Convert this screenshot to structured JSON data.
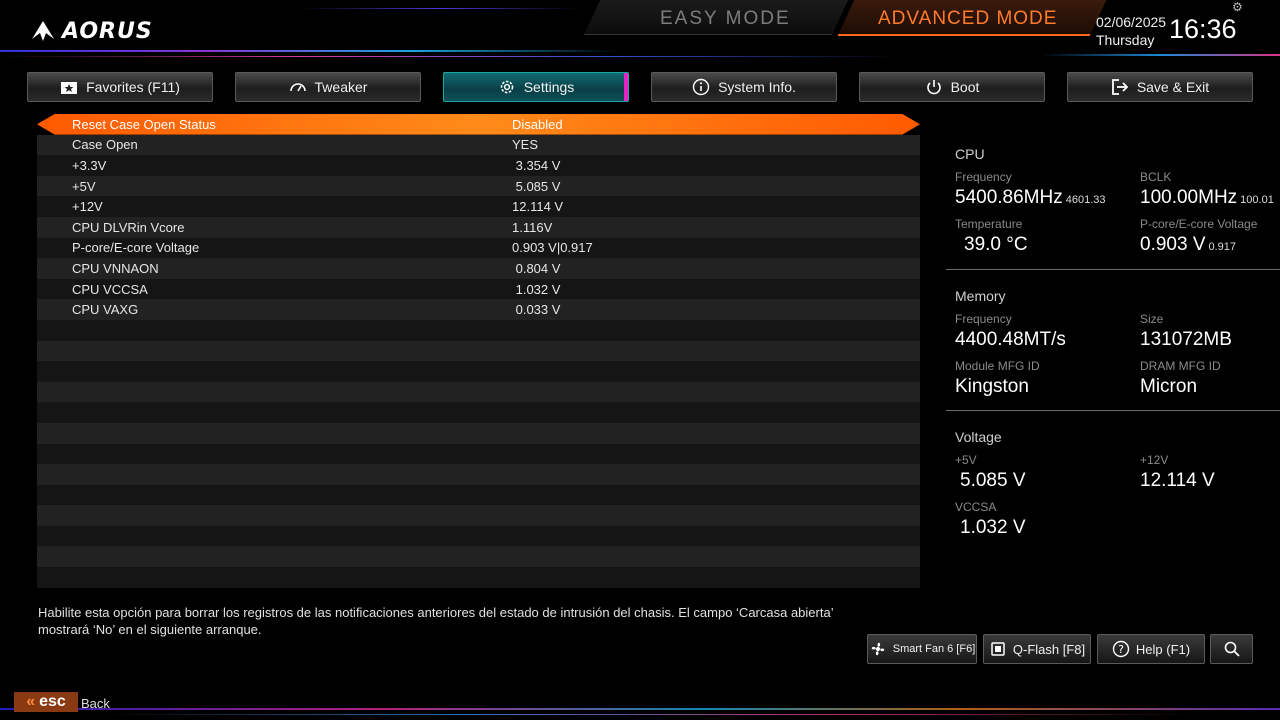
{
  "header": {
    "logo_text": "AORUS",
    "easy_mode": "EASY MODE",
    "advanced_mode": "ADVANCED MODE",
    "date": "02/06/2025",
    "day": "Thursday",
    "time": "16:36"
  },
  "tabs": [
    {
      "label": "Favorites (F11)",
      "icon": "star-folder-icon"
    },
    {
      "label": "Tweaker",
      "icon": "speedometer-icon"
    },
    {
      "label": "Settings",
      "icon": "gear-icon",
      "active": true
    },
    {
      "label": "System Info.",
      "icon": "info-icon"
    },
    {
      "label": "Boot",
      "icon": "power-icon"
    },
    {
      "label": "Save & Exit",
      "icon": "exit-icon"
    }
  ],
  "settings": [
    {
      "label": "Reset Case Open Status",
      "value": "Disabled"
    },
    {
      "label": "Case Open",
      "value": "YES"
    },
    {
      "label": "+3.3V",
      "value": " 3.354 V"
    },
    {
      "label": "+5V",
      "value": " 5.085 V"
    },
    {
      "label": "+12V",
      "value": "12.114 V"
    },
    {
      "label": "CPU DLVRin Vcore",
      "value": "1.116V"
    },
    {
      "label": "P-core/E-core Voltage",
      "value": "0.903 V|0.917"
    },
    {
      "label": "CPU VNNAON",
      "value": " 0.804 V"
    },
    {
      "label": "CPU VCCSA",
      "value": " 1.032 V"
    },
    {
      "label": "CPU VAXG",
      "value": " 0.033 V"
    }
  ],
  "panel": {
    "cpu": {
      "title": "CPU",
      "frequency_label": "Frequency",
      "frequency": "5400.86MHz",
      "frequency_sub": "4601.33",
      "bclk_label": "BCLK",
      "bclk": "100.00MHz",
      "bclk_sub": "100.01",
      "temperature_label": "Temperature",
      "temperature": "39.0 °C",
      "voltage_label": "P-core/E-core Voltage",
      "voltage": "0.903 V",
      "voltage_sub": "0.917"
    },
    "memory": {
      "title": "Memory",
      "frequency_label": "Frequency",
      "frequency": "4400.48MT/s",
      "size_label": "Size",
      "size": "131072MB",
      "module_label": "Module MFG ID",
      "module": "Kingston",
      "dram_label": "DRAM MFG ID",
      "dram": "Micron"
    },
    "voltage": {
      "title": "Voltage",
      "v5_label": "+5V",
      "v5": "5.085 V",
      "v12_label": "+12V",
      "v12": "12.114 V",
      "vccsa_label": "VCCSA",
      "vccsa": "1.032 V"
    }
  },
  "help_text": "Habilite esta opción para borrar los registros de las notificaciones anteriores del estado de intrusión del chasis. El campo ‘Carcasa abierta’ mostrará ‘No’ en el siguiente arranque.",
  "bottom": {
    "smart_fan": "Smart Fan 6 [F6]",
    "qflash": "Q-Flash [F8]",
    "help": "Help (F1)",
    "esc": "esc",
    "back": "Back"
  },
  "colors": {
    "accent_orange": "#ff6a1a",
    "active_tab": "#0c5058",
    "tab_edge": "#e524c8"
  }
}
